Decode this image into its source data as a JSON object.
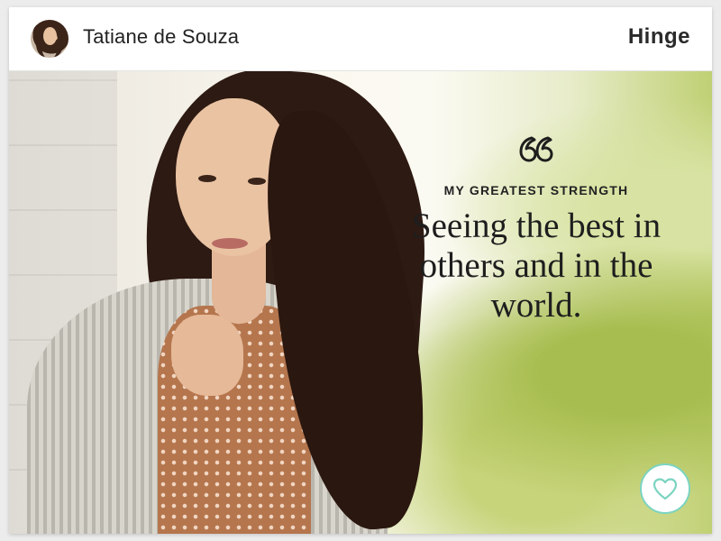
{
  "profile": {
    "name": "Tatiane de Souza"
  },
  "brand": {
    "logo_text": "Hinge"
  },
  "prompt": {
    "label": "MY GREATEST STRENGTH",
    "answer": "Seeing the best in others and in the world."
  },
  "icons": {
    "quote": "quote-icon",
    "like": "heart-icon"
  },
  "colors": {
    "like_accent": "#7bd4c1",
    "text": "#1e1e1e"
  }
}
